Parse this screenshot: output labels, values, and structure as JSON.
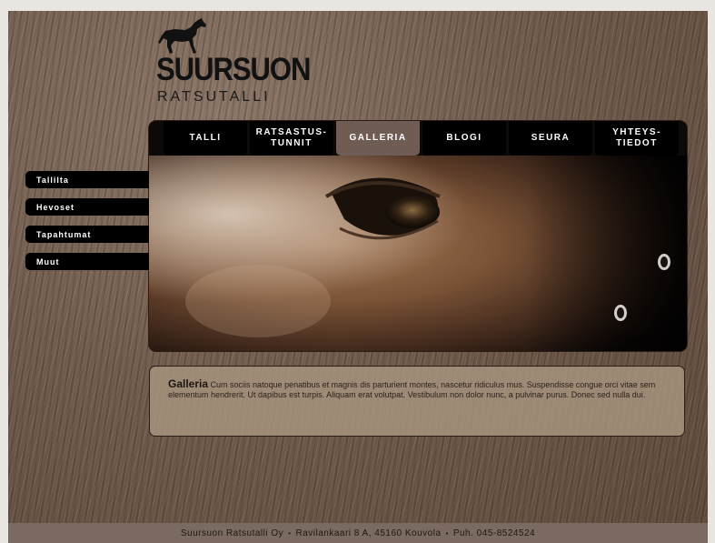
{
  "logo": {
    "name": "SUURSUON",
    "subtitle": "RATSUTALLI",
    "icon": "horse-icon"
  },
  "nav": {
    "items": [
      {
        "label": "TALLI",
        "active": false
      },
      {
        "label": "RATSASTUS-\nTUNNIT",
        "active": false
      },
      {
        "label": "GALLERIA",
        "active": true
      },
      {
        "label": "BLOGI",
        "active": false
      },
      {
        "label": "SEURA",
        "active": false
      },
      {
        "label": "YHTEYS-\nTIEDOT",
        "active": false
      }
    ]
  },
  "sidebar": {
    "items": [
      {
        "label": "Tallilta"
      },
      {
        "label": "Hevoset"
      },
      {
        "label": "Tapahtumat"
      },
      {
        "label": "Muut"
      }
    ]
  },
  "content": {
    "title": "Galleria",
    "text": "Cum sociis natoque penatibus et magnis dis parturient montes, nascetur ridiculus mus. Suspendisse congue orci vitae sem elementum hendrerit. Ut dapibus est turpis. Aliquam erat volutpat. Vestibulum non dolor nunc, a pulvinar purus. Donec sed nulla dui."
  },
  "footer": {
    "company": "Suursuon Ratsutalli Oy",
    "address": "Ravilankaari 8 A, 45160 Kouvola",
    "phone": "Puh. 045-8524524",
    "separator": "•"
  },
  "colors": {
    "nav_bg": "#000000",
    "nav_active": "#6e5c55",
    "footer_bg": "#7b6a61",
    "content_bg": "#a89680"
  }
}
